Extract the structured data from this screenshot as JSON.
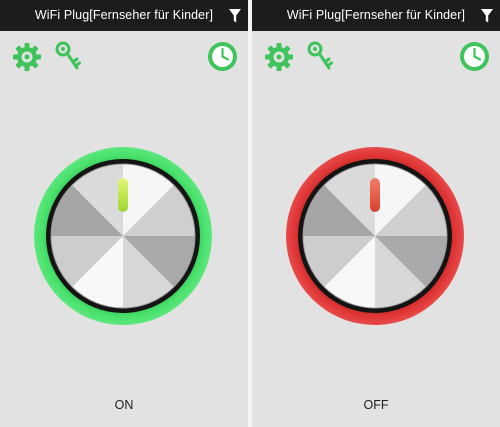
{
  "colors": {
    "on": "#3fd45e",
    "off": "#d93030",
    "icons": "#3ec45a",
    "bar": "#1c1c1c",
    "background": "#e2e2e2"
  },
  "icons": [
    "gear-icon",
    "key-icon",
    "clock-icon",
    "filter-icon"
  ],
  "panels": [
    {
      "title": "WiFi Plug[Fernseher für Kinder]",
      "state_label": "ON",
      "power_on": true
    },
    {
      "title": "WiFi Plug[Fernseher für Kinder]",
      "state_label": "OFF",
      "power_on": false
    }
  ]
}
